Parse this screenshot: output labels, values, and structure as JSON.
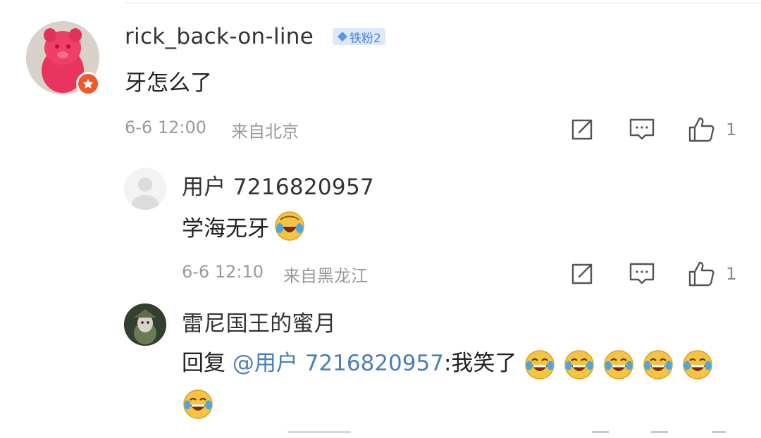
{
  "comments": [
    {
      "username": "rick_back-on-line",
      "badge": "铁粉2",
      "text": "牙怎么了",
      "time": "6-6 12:00",
      "location": "来自北京",
      "likes": "1"
    }
  ],
  "replies": [
    {
      "username": "用户 7216820957",
      "text": "学海无牙",
      "time": "6-6 12:10",
      "location": "来自黑龙江",
      "likes": "1",
      "emoji": "crying-laughing-emoji"
    },
    {
      "username": "雷尼国王的蜜月",
      "reply_prefix": "回复",
      "mention": "@用户 7216820957",
      "text": ":我笑了",
      "emoji_count": 6,
      "emoji": "laughing-tears-emoji"
    }
  ],
  "icons": {
    "share": "share-icon",
    "reply": "comment-icon",
    "like": "thumbs-up-icon"
  },
  "colors": {
    "accent_link": "#4a7fb8",
    "meta_gray": "#9a9a9a",
    "badge_bg": "#dce9fb"
  }
}
